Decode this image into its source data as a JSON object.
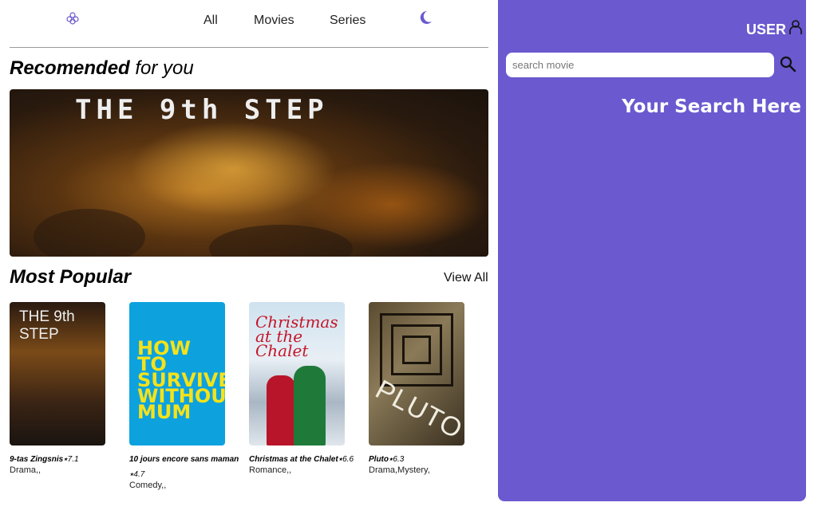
{
  "nav": {
    "items": [
      {
        "label": "All"
      },
      {
        "label": "Movies"
      },
      {
        "label": "Series"
      }
    ],
    "logo_icon": "flower-logo-icon",
    "theme_icon": "moon-icon",
    "accent_color": "#6a59cf"
  },
  "recommended": {
    "title_bold": "Recomended",
    "title_light": "for you",
    "banner_title": "THE 9th STEP"
  },
  "popular": {
    "title": "Most Popular",
    "view_all": "View All",
    "movies": [
      {
        "title": "9-tas Zingsnis",
        "rating": "7.1",
        "genre": "Drama,,",
        "poster_text": "THE 9th STEP"
      },
      {
        "title": "10 jours encore sans maman",
        "rating": "4.7",
        "genre": "Comedy,,",
        "poster_text": "HOW TO SURVIVE WITHOUT MUM"
      },
      {
        "title": "Christmas at the Chalet",
        "rating": "6.6",
        "genre": "Romance,,",
        "poster_text": "Christmas at the Chalet"
      },
      {
        "title": "Pluto",
        "rating": "6.3",
        "genre": "Drama,Mystery,",
        "poster_text": "PLUTO"
      }
    ]
  },
  "panel": {
    "user_label": "USER",
    "user_icon": "user-icon",
    "search_placeholder": "search movie",
    "search_icon": "magnifier-icon",
    "results_heading": "Your Search Here"
  }
}
